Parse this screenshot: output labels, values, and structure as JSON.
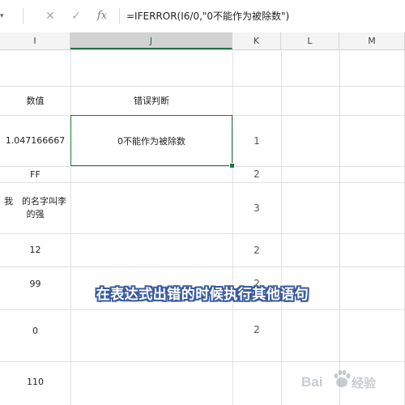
{
  "formula_bar": {
    "namebox_fragment": "▾",
    "cancel_icon": "✕",
    "enter_icon": "✓",
    "fx_label": "fx",
    "formula": "=IFERROR(I6/0,\"0不能作为被除数\")"
  },
  "columns": [
    "I",
    "J",
    "K",
    "L",
    "M"
  ],
  "selected_column": "J",
  "rows": [
    {
      "I": "",
      "J": "",
      "K": ""
    },
    {
      "I": "数值",
      "J": "错误判断",
      "K": ""
    },
    {
      "I": "1.047166667",
      "J": "0不能作为被除数",
      "K": "1"
    },
    {
      "I": "FF",
      "J": "",
      "K": "2"
    },
    {
      "I": "我　的名字叫李的强",
      "J": "",
      "K": "3"
    },
    {
      "I": "12",
      "J": "",
      "K": "2"
    },
    {
      "I": "99",
      "J": "",
      "K": "2"
    },
    {
      "I": "0",
      "J": "",
      "K": "2"
    },
    {
      "I": "110",
      "J": "",
      "K": ""
    }
  ],
  "caption": "在表达式出错的时候执行其他语句",
  "watermark": {
    "text1": "Bai",
    "text2": "经验",
    "icon": "paw-icon"
  },
  "colors": {
    "accent": "#217346",
    "caption_outline": "#3a5ba0"
  }
}
